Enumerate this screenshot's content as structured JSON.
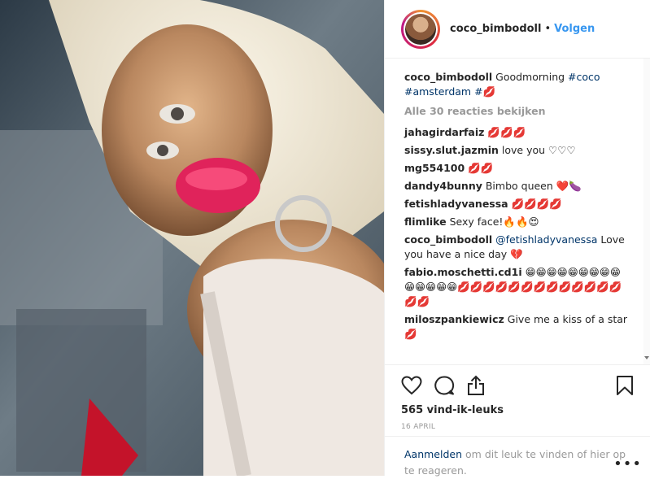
{
  "header": {
    "username": "coco_bimbodoll",
    "separator": "•",
    "follow_label": "Volgen"
  },
  "caption": {
    "username": "coco_bimbodoll",
    "text": "Goodmorning",
    "tag1": "#coco",
    "tag2": "#amsterdam",
    "tag3": "#💋"
  },
  "view_all": "Alle 30 reacties bekijken",
  "comments": [
    {
      "user": "jahagirdarfaiz",
      "text": "💋💋💋"
    },
    {
      "user": "sissy.slut.jazmin",
      "text": "love you ♡♡♡"
    },
    {
      "user": "mg554100",
      "text": "💋💋"
    },
    {
      "user": "dandy4bunny",
      "text": "Bimbo queen ❤️🍆"
    },
    {
      "user": "fetishladyvanessa",
      "text": "💋💋💋💋"
    },
    {
      "user": "flimlike",
      "text": "Sexy face!🔥🔥😍"
    },
    {
      "user": "coco_bimbodoll",
      "mention": "@fetishladyvanessa",
      "text": "Love you have a nice day 💔"
    },
    {
      "user": "fabio.moschetti.cd1i",
      "text": "😁😁😁😁😁😁😁😁😁😁😁😁😁😁💋💋💋💋💋💋💋💋💋💋💋💋💋💋💋"
    },
    {
      "user": "miloszpankiewicz",
      "text": "Give me a kiss of a star 💋"
    }
  ],
  "likes": "565 vind-ik-leuks",
  "date": "16 APRIL",
  "login": {
    "link": "Aanmelden",
    "text": "om dit leuk te vinden of hier op te reageren."
  },
  "more": "•••",
  "icons": {
    "like": "heart-icon",
    "comment": "comment-icon",
    "share": "share-icon",
    "save": "bookmark-icon"
  },
  "colors": {
    "link": "#3897f0",
    "hashtag": "#003569",
    "muted": "#999999"
  }
}
